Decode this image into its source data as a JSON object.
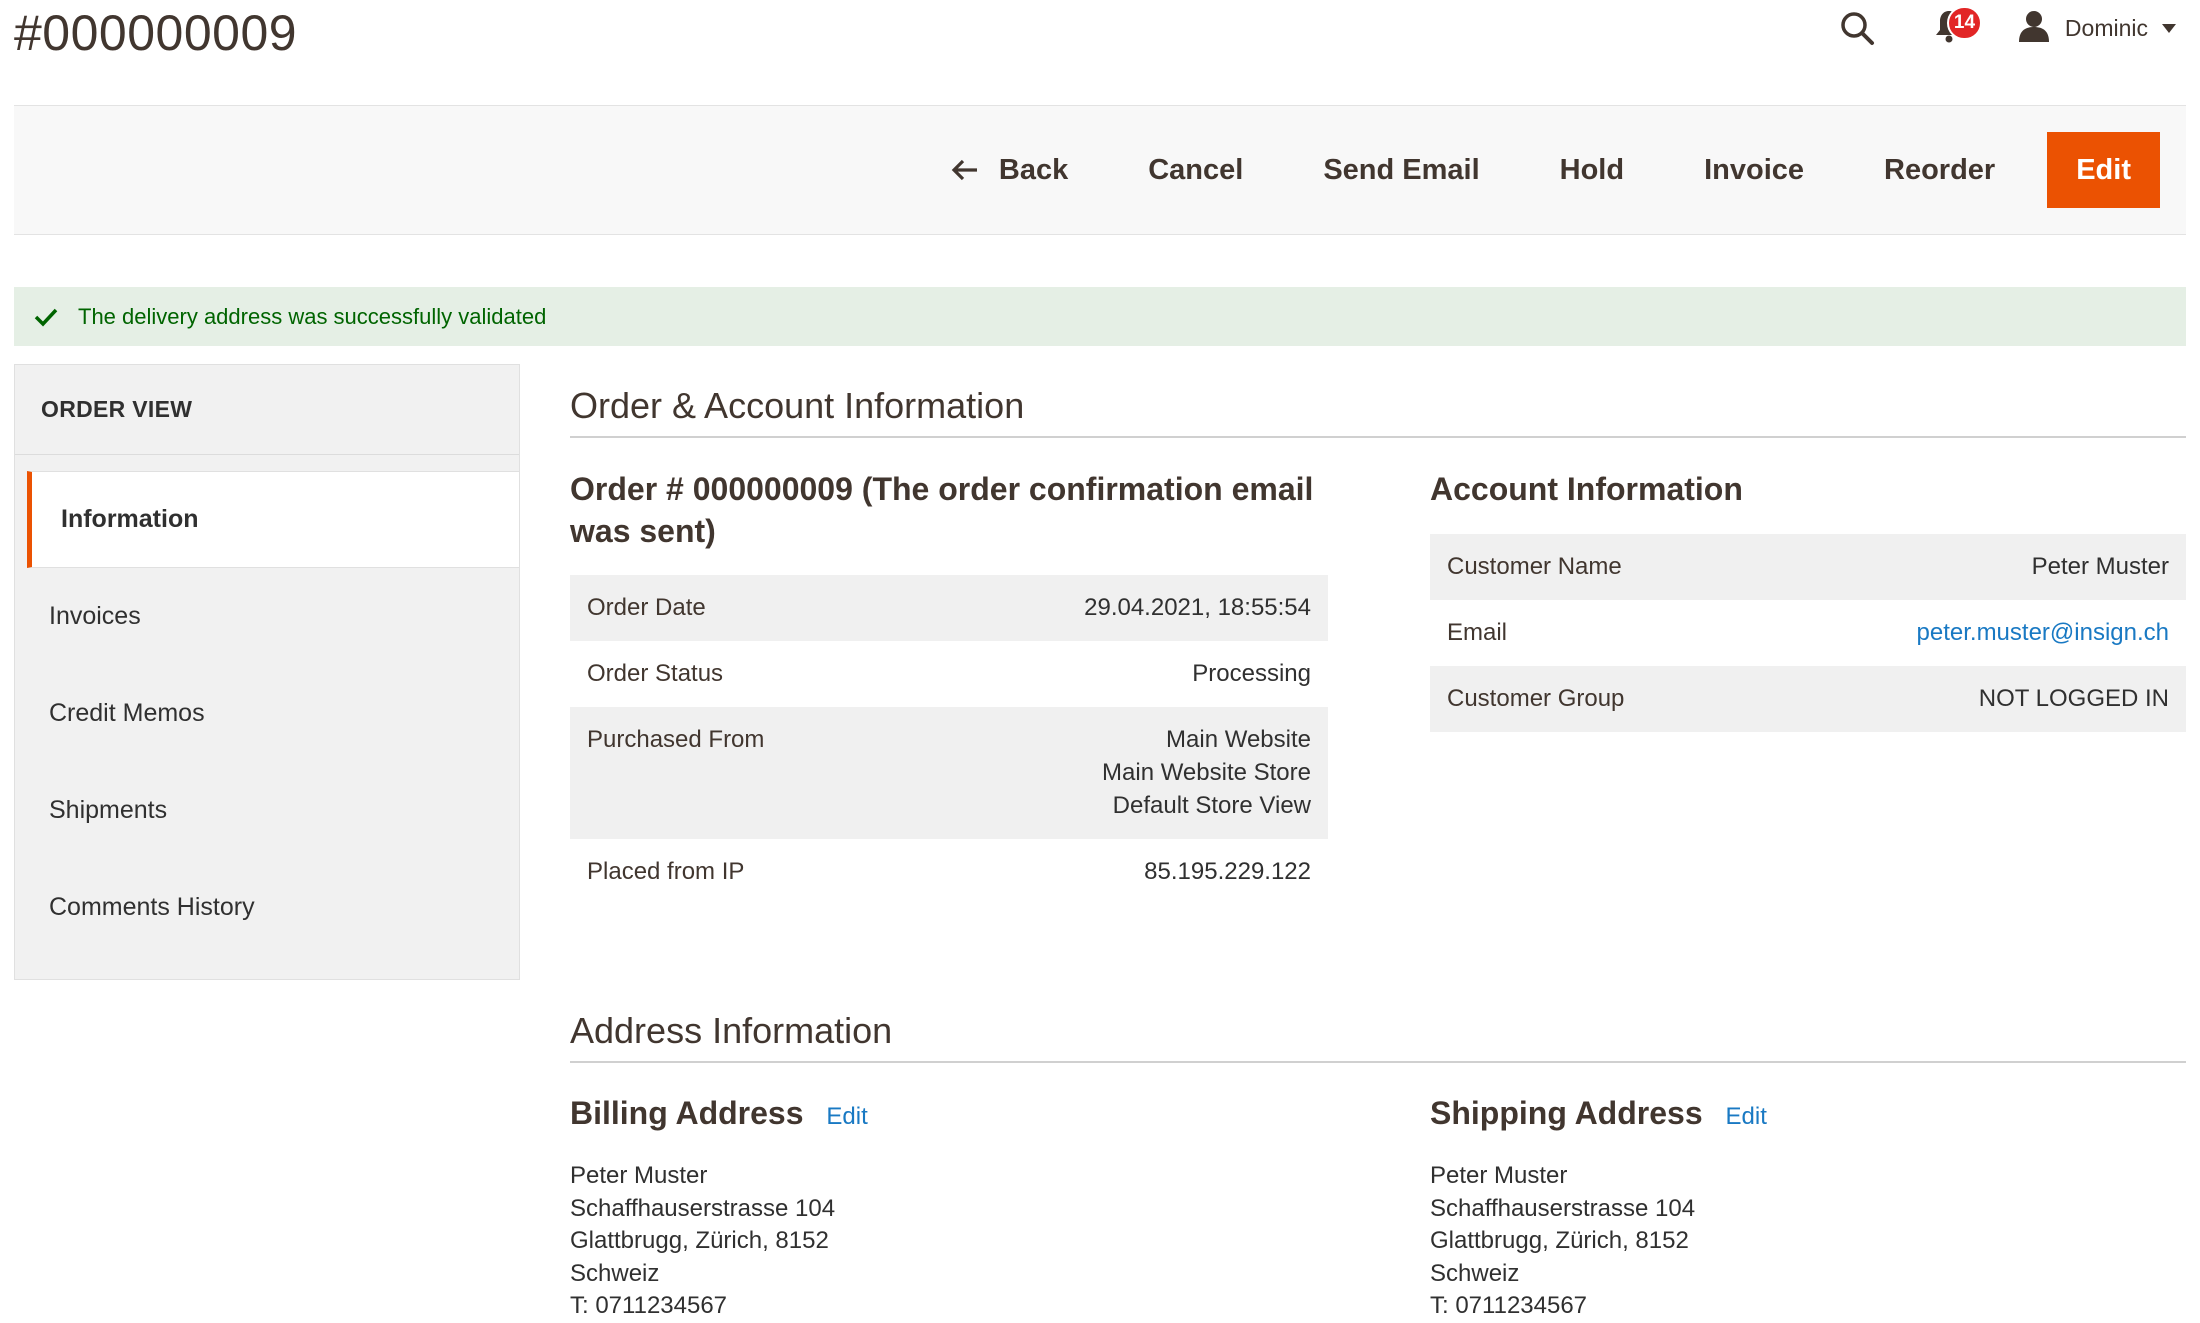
{
  "header": {
    "title": "#000000009",
    "notifications_count": "14",
    "user_name": "Dominic"
  },
  "actions": {
    "back": "Back",
    "cancel": "Cancel",
    "send_email": "Send Email",
    "hold": "Hold",
    "invoice": "Invoice",
    "reorder": "Reorder",
    "edit": "Edit"
  },
  "message": {
    "text": "The delivery address was successfully validated"
  },
  "sidebar": {
    "title": "ORDER VIEW",
    "items": [
      {
        "label": "Information"
      },
      {
        "label": "Invoices"
      },
      {
        "label": "Credit Memos"
      },
      {
        "label": "Shipments"
      },
      {
        "label": "Comments History"
      }
    ]
  },
  "order_section": {
    "title": "Order & Account Information",
    "order_title_line1": "Order # 000000009 (The order confirmation email",
    "order_title_line2": "was sent)",
    "order_rows": [
      {
        "label": "Order Date",
        "value": "29.04.2021, 18:55:54"
      },
      {
        "label": "Order Status",
        "value": "Processing"
      },
      {
        "label": "Purchased From",
        "value_lines": [
          "Main Website",
          "Main Website Store",
          "Default Store View"
        ]
      },
      {
        "label": "Placed from IP",
        "value": "85.195.229.122"
      }
    ],
    "account_title": "Account Information",
    "account_rows": [
      {
        "label": "Customer Name",
        "value": "Peter Muster"
      },
      {
        "label": "Email",
        "value": "peter.muster@insign.ch"
      },
      {
        "label": "Customer Group",
        "value": "NOT LOGGED IN"
      }
    ]
  },
  "address_section": {
    "title": "Address Information",
    "billing": {
      "title": "Billing Address",
      "edit_label": "Edit",
      "lines": [
        "Peter Muster",
        "Schaffhauserstrasse 104",
        "Glattbrugg, Zürich, 8152",
        "Schweiz",
        "T: 0711234567"
      ]
    },
    "shipping": {
      "title": "Shipping Address",
      "edit_label": "Edit",
      "lines": [
        "Peter Muster",
        "Schaffhauserstrasse 104",
        "Glattbrugg, Zürich, 8152",
        "Schweiz",
        "T: 0711234567"
      ]
    }
  },
  "colors": {
    "accent": "#eb5202",
    "link": "#1979c3",
    "success_bg": "#e5efe5",
    "success_text": "#006400",
    "badge": "#e22626"
  }
}
